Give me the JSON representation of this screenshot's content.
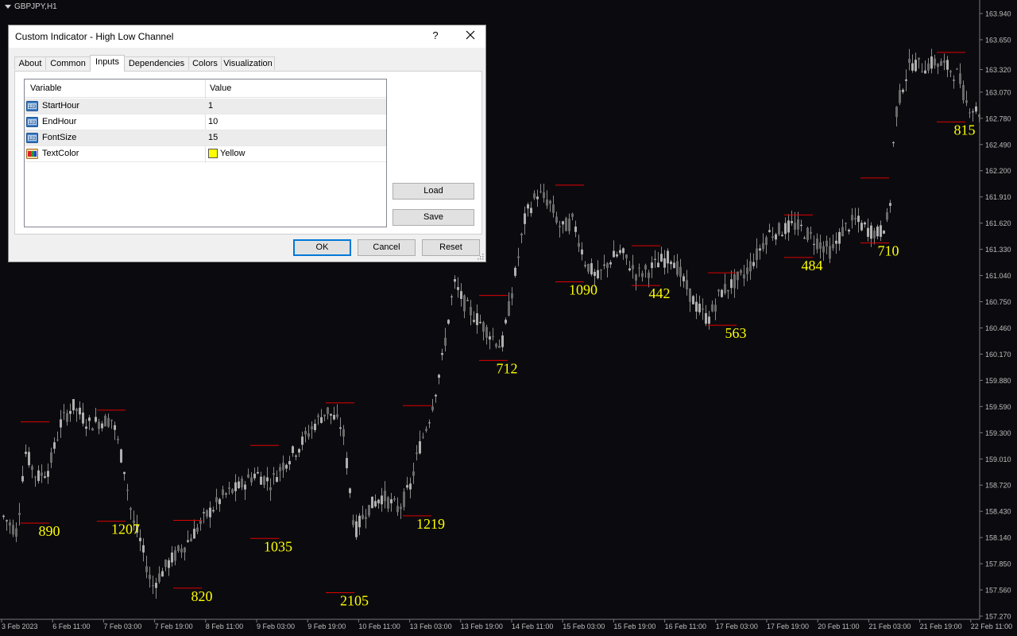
{
  "chart": {
    "symbol_label": "GBPJPY,H1",
    "background": "#0b0b0f",
    "candle_color": "#9a9a9a",
    "level_color": "#e00000",
    "label_color": "#ffff00",
    "price_ticks": [
      "163.940",
      "163.650",
      "163.320",
      "163.070",
      "162.780",
      "162.490",
      "162.200",
      "161.910",
      "161.620",
      "161.330",
      "161.040",
      "160.750",
      "160.460",
      "160.170",
      "159.880",
      "159.590",
      "159.300",
      "159.010",
      "158.720",
      "158.430",
      "158.140",
      "157.850",
      "157.560",
      "157.270"
    ],
    "time_ticks": [
      "3 Feb 2023",
      "6 Feb 11:00",
      "7 Feb 03:00",
      "7 Feb 19:00",
      "8 Feb 11:00",
      "9 Feb 03:00",
      "9 Feb 19:00",
      "10 Feb 11:00",
      "13 Feb 03:00",
      "13 Feb 19:00",
      "14 Feb 11:00",
      "15 Feb 03:00",
      "15 Feb 19:00",
      "16 Feb 11:00",
      "17 Feb 03:00",
      "17 Feb 19:00",
      "20 Feb 11:00",
      "21 Feb 03:00",
      "21 Feb 19:00",
      "22 Feb 11:00"
    ],
    "range_labels": [
      "890",
      "1207",
      "820",
      "1035",
      "2105",
      "1219",
      "712",
      "1090",
      "442",
      "563",
      "484",
      "710",
      "815"
    ],
    "channels": [
      {
        "high": 159.42,
        "low": 158.3
      },
      {
        "high": 159.55,
        "low": 158.32
      },
      {
        "high": 158.33,
        "low": 157.58
      },
      {
        "high": 159.16,
        "low": 158.13
      },
      {
        "high": 159.63,
        "low": 157.53
      },
      {
        "high": 159.6,
        "low": 158.38
      },
      {
        "high": 160.82,
        "low": 160.1
      },
      {
        "high": 162.04,
        "low": 160.97
      },
      {
        "high": 161.37,
        "low": 160.93
      },
      {
        "high": 161.07,
        "low": 160.49
      },
      {
        "high": 161.71,
        "low": 161.24
      },
      {
        "high": 162.12,
        "low": 161.4
      },
      {
        "high": 163.51,
        "low": 162.74
      }
    ]
  },
  "dialog": {
    "title": "Custom Indicator - High Low Channel",
    "help": "?",
    "tabs": [
      "About",
      "Common",
      "Inputs",
      "Dependencies",
      "Colors",
      "Visualization"
    ],
    "active_tab": "Inputs",
    "columns": [
      "Variable",
      "Value"
    ],
    "inputs": [
      {
        "name": "StartHour",
        "value": "1",
        "icon": "number-icon"
      },
      {
        "name": "EndHour",
        "value": "10",
        "icon": "number-icon"
      },
      {
        "name": "FontSize",
        "value": "15",
        "icon": "number-icon"
      },
      {
        "name": "TextColor",
        "value": "Yellow",
        "icon": "color-icon",
        "swatch": "#ffff00"
      }
    ],
    "side_buttons": {
      "load": "Load",
      "save": "Save"
    },
    "buttons": {
      "ok": "OK",
      "cancel": "Cancel",
      "reset": "Reset"
    }
  }
}
